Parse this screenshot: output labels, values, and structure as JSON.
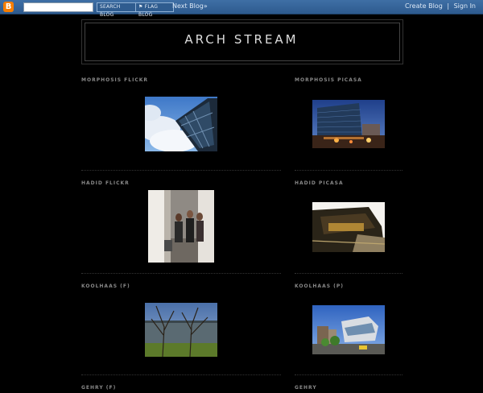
{
  "navbar": {
    "search_button": "SEARCH BLOG",
    "flag_button": "FLAG BLOG",
    "next_blog": "Next Blog»",
    "create_blog": "Create Blog",
    "separator": "|",
    "sign_in": "Sign In"
  },
  "blog": {
    "title": "ARCH STREAM"
  },
  "widgets": {
    "w1": {
      "title": "MORPHOSIS FLICKR"
    },
    "w2": {
      "title": "MORPHOSIS PICASA"
    },
    "w3": {
      "title": "HADID FLICKR"
    },
    "w4": {
      "title": "HADID PICASA"
    },
    "w5": {
      "title": "KOOLHAAS (F)"
    },
    "w6": {
      "title": "KOOLHAAS (P)"
    },
    "w7": {
      "title": "GEHRY (F)"
    },
    "w8": {
      "title": "GEHRY"
    }
  }
}
